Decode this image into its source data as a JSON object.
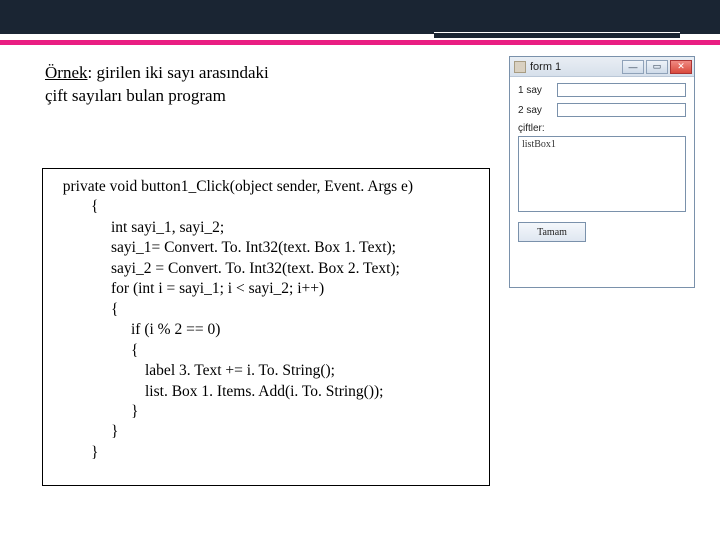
{
  "heading": {
    "label_underlined": "Örnek",
    "rest_line1": ": girilen iki sayı arasındaki",
    "line2": "çift sayıları bulan program"
  },
  "code": {
    "l1": "  private void button1_Click(object sender, Event. Args e)",
    "l2": "{",
    "l3": "int sayi_1, sayi_2;",
    "l4": "sayi_1= Convert. To. Int32(text. Box 1. Text);",
    "l5": "sayi_2 = Convert. To. Int32(text. Box 2. Text);",
    "l6": "for (int i = sayi_1; i < sayi_2; i++)",
    "l7": "{",
    "l8": "if (i % 2 == 0)",
    "l9": "{",
    "l10": "label 3. Text += i. To. String();",
    "l11": "list. Box 1. Items. Add(i. To. String());",
    "l12": "}",
    "l13": "}",
    "l14": "}"
  },
  "window": {
    "title": "form 1",
    "label1": "1 say",
    "label2": "2 say",
    "section_label": "çiftler:",
    "listbox_text": "listBox1",
    "button_label": "Tamam",
    "min_symbol": "—",
    "max_symbol": "▭",
    "close_symbol": "✕"
  }
}
